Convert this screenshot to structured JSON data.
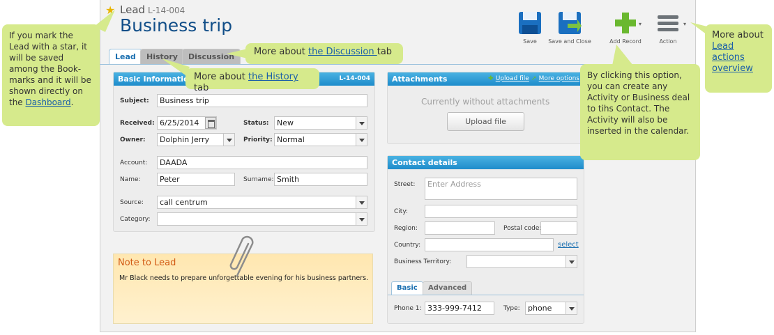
{
  "header": {
    "entity_type": "Lead",
    "entity_id": "L-14-004",
    "title": "Business trip"
  },
  "toolbar": {
    "save": "Save",
    "save_close": "Save and Close",
    "add_record": "Add Record",
    "action": "Action"
  },
  "tabs": [
    "Lead",
    "History",
    "Discussion"
  ],
  "basic_info": {
    "heading": "Basic Information",
    "record_id": "L-14-004",
    "subject_label": "Subject:",
    "subject_value": "Business trip",
    "received_label": "Received:",
    "received_value": "6/25/2014",
    "status_label": "Status:",
    "status_value": "New",
    "owner_label": "Owner:",
    "owner_value": "Dolphin Jerry",
    "priority_label": "Priority:",
    "priority_value": "Normal",
    "account_label": "Account:",
    "account_value": "DAADA",
    "name_label": "Name:",
    "name_value": "Peter",
    "surname_label": "Surname:",
    "surname_value": "Smith",
    "source_label": "Source:",
    "source_value": "call centrum",
    "category_label": "Category:",
    "category_value": ""
  },
  "note": {
    "title": "Note to Lead",
    "text": "Mr Black needs to prepare unforgettable evening for his business partners."
  },
  "attachments": {
    "heading": "Attachments",
    "upload_link": "Upload file",
    "more_options": "More options",
    "empty_text": "Currently without attachments",
    "upload_button": "Upload file"
  },
  "contact": {
    "heading": "Contact details",
    "street_label": "Street:",
    "street_placeholder": "Enter Address",
    "city_label": "City:",
    "region_label": "Region:",
    "postal_label": "Postal code:",
    "country_label": "Country:",
    "country_select": "select",
    "territory_label": "Business Territory:",
    "subtabs": [
      "Basic",
      "Advanced"
    ],
    "phone_label": "Phone 1:",
    "phone_value": "333-999-7412",
    "type_label": "Type:",
    "type_value": "phone"
  },
  "callouts": {
    "star": {
      "text": "If you mark the Lead with a star, it will be saved among the Book-marks and it will be shown directly on the ",
      "link": "Dashboard",
      "suffix": "."
    },
    "discussion": {
      "prefix": "More about ",
      "link": "the Discussion ",
      "suffix": " tab"
    },
    "history": {
      "prefix": "More about ",
      "link": "the History",
      "suffix": " tab"
    },
    "add_record": {
      "text": "By clicking this option, you can create any Activity or Business deal to tihs Contact. The Activity will also be inserted in the calendar."
    },
    "actions": {
      "prefix": "More about",
      "link1": "Lead",
      "link2": "actions",
      "link3": "overview"
    }
  },
  "colors": {
    "header_blue": "#1e8ccb",
    "callout_green": "#d6ea8c",
    "title_blue": "#114e88",
    "note_orange": "#d25a14"
  }
}
